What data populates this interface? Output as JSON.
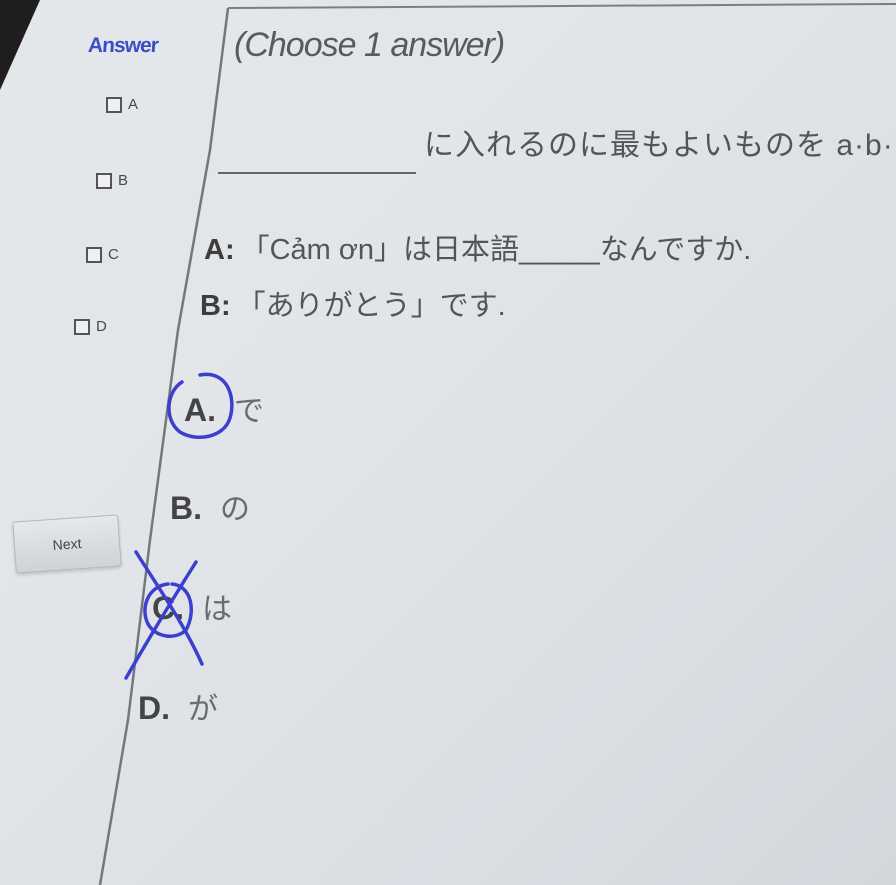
{
  "sidebar": {
    "answer_label": "Answer",
    "options": [
      {
        "label": "A"
      },
      {
        "label": "B"
      },
      {
        "label": "C"
      },
      {
        "label": "D"
      }
    ],
    "next_label": "Next"
  },
  "question": {
    "instruction": "(Choose 1 answer)",
    "prompt": "に入れるのに最もよいものを a·b·",
    "dialog": [
      {
        "speaker": "A:",
        "text_before": "「Cảm ơn」は日本語",
        "blank": "_____",
        "text_after": "なんですか."
      },
      {
        "speaker": "B:",
        "text": "「ありがとう」です."
      }
    ],
    "choices": [
      {
        "letter": "A.",
        "text": "で"
      },
      {
        "letter": "B.",
        "text": "の"
      },
      {
        "letter": "C.",
        "text": "は"
      },
      {
        "letter": "D.",
        "text": "が"
      }
    ]
  },
  "colors": {
    "accent": "#3c4fc2",
    "ink": "#3a3fd0",
    "text": "#555555",
    "background": "#e2e6e9"
  }
}
